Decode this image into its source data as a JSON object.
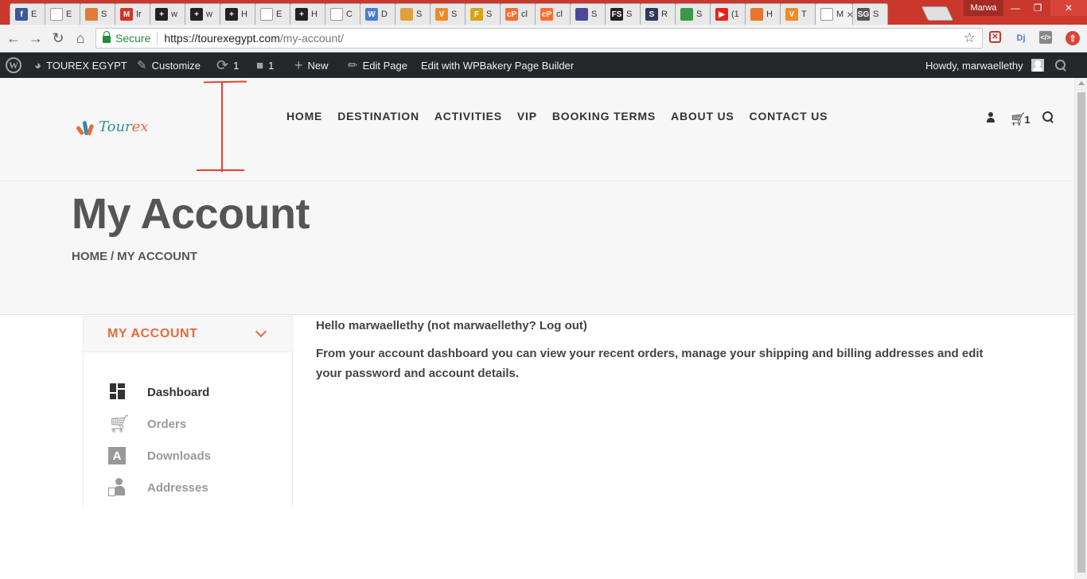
{
  "browser": {
    "tabs": [
      {
        "letter": "f",
        "color": "#3b5998",
        "title": "E"
      },
      {
        "letter": "",
        "color": "#ffffff",
        "title": "E"
      },
      {
        "letter": "",
        "color": "#e07b39",
        "title": "S"
      },
      {
        "letter": "M",
        "color": "#d93025",
        "title": "Ir"
      },
      {
        "letter": "+",
        "color": "#222222",
        "title": "w"
      },
      {
        "letter": "+",
        "color": "#222222",
        "title": "w"
      },
      {
        "letter": "+",
        "color": "#222222",
        "title": "H"
      },
      {
        "letter": "",
        "color": "#ffffff",
        "title": "E"
      },
      {
        "letter": "+",
        "color": "#222222",
        "title": "H"
      },
      {
        "letter": "",
        "color": "#ffffff",
        "title": "C"
      },
      {
        "letter": "W",
        "color": "#4a7fd0",
        "title": "D"
      },
      {
        "letter": "",
        "color": "#e0a040",
        "title": "S"
      },
      {
        "letter": "V",
        "color": "#f08a24",
        "title": "S"
      },
      {
        "letter": "F",
        "color": "#d9a21b",
        "title": "S"
      },
      {
        "letter": "cP",
        "color": "#ff6c2c",
        "title": "cl"
      },
      {
        "letter": "cP",
        "color": "#ff6c2c",
        "title": "cl"
      },
      {
        "letter": "",
        "color": "#4a4a9a",
        "title": "S"
      },
      {
        "letter": "FS",
        "color": "#222222",
        "title": "S"
      },
      {
        "letter": "S",
        "color": "#2f3a5a",
        "title": "R"
      },
      {
        "letter": "",
        "color": "#3a9a4a",
        "title": "S"
      },
      {
        "letter": "▶",
        "color": "#e62117",
        "title": "(1"
      },
      {
        "letter": "",
        "color": "#e8742a",
        "title": "H"
      },
      {
        "letter": "V",
        "color": "#f08a24",
        "title": "T"
      },
      {
        "letter": "",
        "color": "#f2f2f2",
        "title": "M",
        "active": true
      },
      {
        "letter": "SG",
        "color": "#555555",
        "title": "S"
      }
    ],
    "profile_name": "Marwa",
    "secure_label": "Secure",
    "url_scheme_host": "https://tourexegypt.com",
    "url_path": "/my-account/"
  },
  "adminbar": {
    "site_name": "TOUREX EGYPT",
    "customize": "Customize",
    "updates_count": "1",
    "comments_count": "1",
    "new_label": "New",
    "edit_page": "Edit Page",
    "wpbakery": "Edit with WPBakery Page Builder",
    "howdy": "Howdy, marwaellethy"
  },
  "header": {
    "logo_text_a": "Tour",
    "logo_text_b": "ex",
    "nav": [
      "HOME",
      "DESTINATION",
      "ACTIVITIES",
      "VIP",
      "BOOKING TERMS",
      "ABOUT US",
      "CONTACT US"
    ],
    "cart_count": "1"
  },
  "title_band": {
    "title": "My Account",
    "crumb_home": "HOME",
    "crumb_sep": "/",
    "crumb_current": "MY ACCOUNT"
  },
  "account_menu": {
    "heading": "MY ACCOUNT",
    "items": [
      "Dashboard",
      "Orders",
      "Downloads",
      "Addresses"
    ]
  },
  "content": {
    "hello": "Hello marwaellethy (not marwaellethy? Log out)",
    "description": "From your account dashboard you can view your recent orders, manage your shipping and billing addresses and edit your password and account details."
  },
  "colors": {
    "accent": "#ea6a3a",
    "admin_bar": "#23282d",
    "tab_strip": "#c9372d",
    "annotation": "#e8412c"
  }
}
